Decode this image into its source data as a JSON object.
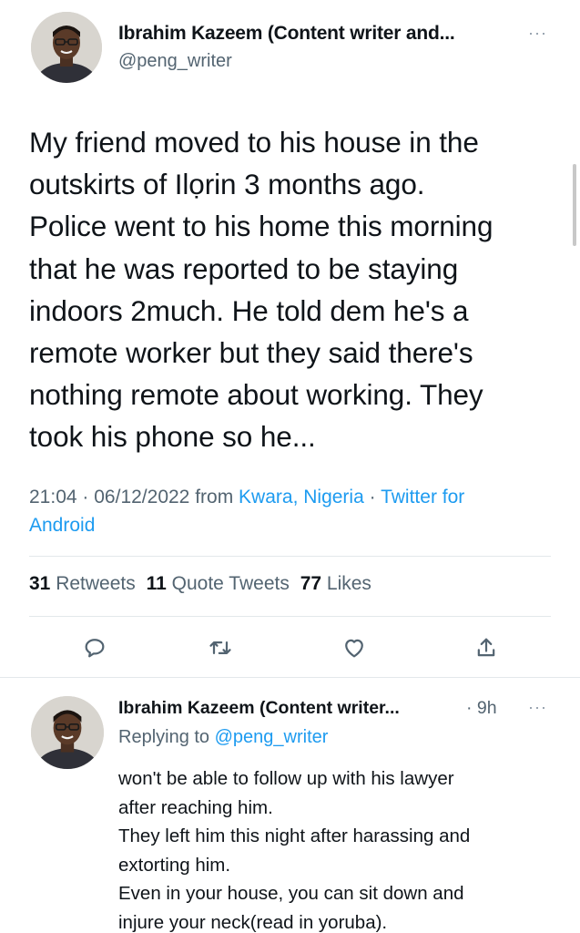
{
  "tweet": {
    "author_name": "Ibrahim Kazeem (Content writer and...",
    "handle": "@peng_writer",
    "more_label": "···",
    "text_lines": [
      "My friend moved to his house in the",
      "outskirts of Ilọrin 3 months ago.",
      "Police went to his home this morning",
      "that he was reported to be staying",
      "indoors 2much. He told dem he's a",
      "remote worker but they said there's",
      "nothing remote about working. They",
      "took his phone so he..."
    ],
    "time": "21:04",
    "sep1": "·",
    "date": "06/12/2022",
    "from_label": "from",
    "location": "Kwara, Nigeria",
    "sep2": "·",
    "source_line1": "Twitter for",
    "source_line2": "Android",
    "retweets_count": "31",
    "retweets_label": "Retweets",
    "quotes_count": "11",
    "quotes_label": "Quote Tweets",
    "likes_count": "77",
    "likes_label": "Likes"
  },
  "reply": {
    "author_name": "Ibrahim Kazeem (Content writer...",
    "time": "· 9h",
    "more_label": "···",
    "replying_prefix": "Replying to",
    "replying_handle": "@peng_writer",
    "text_lines": [
      "won't be able to follow up with his lawyer",
      "after reaching him.",
      "They left him this night after harassing and",
      "extorting him.",
      "Even in your house, you can sit down and",
      "injure your neck(read in yoruba)."
    ]
  },
  "colors": {
    "link": "#1d9bf0",
    "secondary_text": "#536471",
    "primary_text": "#0f1419"
  },
  "icons": {
    "reply": "reply-icon",
    "retweet": "retweet-icon",
    "like": "heart-icon",
    "share": "share-icon",
    "more": "more-icon"
  }
}
